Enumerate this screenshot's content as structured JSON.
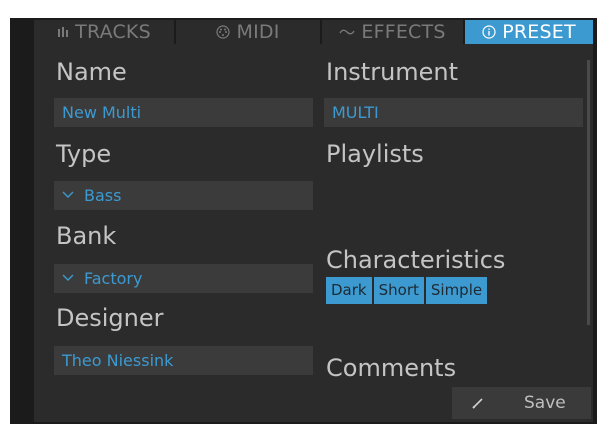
{
  "tabs": [
    {
      "label": "TRACKS",
      "icon": "tracks-icon"
    },
    {
      "label": "MIDI",
      "icon": "midi-icon"
    },
    {
      "label": "EFFECTS",
      "icon": "effects-icon"
    },
    {
      "label": "PRESET",
      "icon": "info-icon"
    }
  ],
  "active_tab": "PRESET",
  "left": {
    "name_label": "Name",
    "name_value": "New Multi",
    "type_label": "Type",
    "type_value": "Bass",
    "bank_label": "Bank",
    "bank_value": "Factory",
    "designer_label": "Designer",
    "designer_value": "Theo Niessink"
  },
  "right": {
    "instrument_label": "Instrument",
    "instrument_value": "MULTI",
    "playlists_label": "Playlists",
    "characteristics_label": "Characteristics",
    "characteristics": [
      "Dark",
      "Short",
      "Simple"
    ],
    "comments_label": "Comments"
  },
  "save_label": "Save",
  "colors": {
    "accent": "#3c9ad1",
    "panel": "#2b2b2b",
    "field": "#3b3b3b",
    "text": "#c4c4c4"
  }
}
